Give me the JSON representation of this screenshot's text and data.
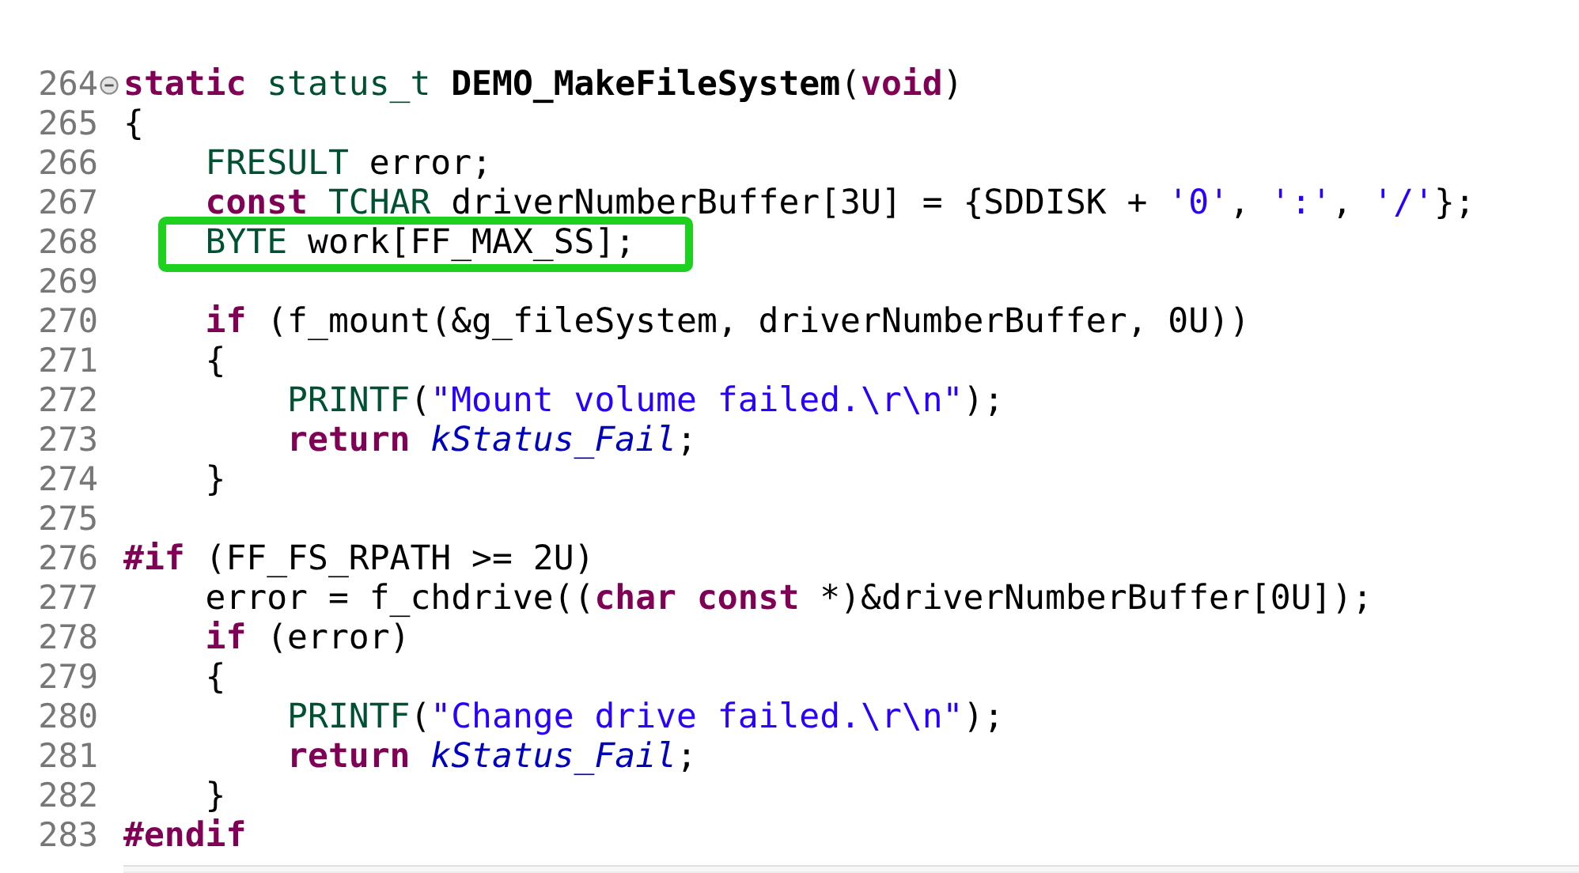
{
  "editor": {
    "lines": [
      {
        "number": "264",
        "foldable": true,
        "boxed": false,
        "tokens": [
          {
            "kind": "keyword",
            "text": "static"
          },
          {
            "kind": "type",
            "text": " status_t"
          },
          {
            "kind": "declaration",
            "text": " DEMO_MakeFileSystem"
          },
          {
            "kind": "plain",
            "text": "("
          },
          {
            "kind": "keyword",
            "text": "void"
          },
          {
            "kind": "plain",
            "text": ")"
          }
        ]
      },
      {
        "number": "265",
        "foldable": false,
        "boxed": false,
        "tokens": [
          {
            "kind": "plain",
            "text": "{"
          }
        ]
      },
      {
        "number": "266",
        "foldable": false,
        "boxed": false,
        "tokens": [
          {
            "kind": "type",
            "text": "    FRESULT"
          },
          {
            "kind": "plain",
            "text": " error;"
          }
        ]
      },
      {
        "number": "267",
        "foldable": false,
        "boxed": false,
        "tokens": [
          {
            "kind": "keyword",
            "text": "    const"
          },
          {
            "kind": "type",
            "text": " TCHAR"
          },
          {
            "kind": "plain",
            "text": " driverNumberBuffer[3U] = {SDDISK + "
          },
          {
            "kind": "string",
            "text": "'0'"
          },
          {
            "kind": "plain",
            "text": ", "
          },
          {
            "kind": "string",
            "text": "':'"
          },
          {
            "kind": "plain",
            "text": ", "
          },
          {
            "kind": "string",
            "text": "'/'"
          },
          {
            "kind": "plain",
            "text": "};"
          }
        ]
      },
      {
        "number": "268",
        "foldable": false,
        "boxed": true,
        "tokens": [
          {
            "kind": "type",
            "text": "    BYTE"
          },
          {
            "kind": "plain",
            "text": " work[FF_MAX_SS];"
          }
        ]
      },
      {
        "number": "269",
        "foldable": false,
        "boxed": false
      },
      {
        "number": "270",
        "foldable": false,
        "boxed": false,
        "tokens": [
          {
            "kind": "keyword",
            "text": "    if"
          },
          {
            "kind": "plain",
            "text": " (f_mount(&g_fileSystem, driverNumberBuffer, 0U))"
          }
        ]
      },
      {
        "number": "271",
        "foldable": false,
        "boxed": false,
        "tokens": [
          {
            "kind": "plain",
            "text": "    {"
          }
        ]
      },
      {
        "number": "272",
        "foldable": false,
        "boxed": false,
        "tokens": [
          {
            "kind": "type",
            "text": "        PRINTF"
          },
          {
            "kind": "plain",
            "text": "("
          },
          {
            "kind": "string",
            "text": "\"Mount volume failed.\\r\\n\""
          },
          {
            "kind": "plain",
            "text": ");"
          }
        ]
      },
      {
        "number": "273",
        "foldable": false,
        "boxed": false,
        "tokens": [
          {
            "kind": "keyword",
            "text": "        return"
          },
          {
            "kind": "enum",
            "text": " kStatus_Fail"
          },
          {
            "kind": "plain",
            "text": ";"
          }
        ]
      },
      {
        "number": "274",
        "foldable": false,
        "boxed": false,
        "tokens": [
          {
            "kind": "plain",
            "text": "    }"
          }
        ]
      },
      {
        "number": "275",
        "foldable": false,
        "boxed": false
      },
      {
        "number": "276",
        "foldable": false,
        "boxed": false,
        "tokens": [
          {
            "kind": "keyword",
            "text": "#if"
          },
          {
            "kind": "plain",
            "text": " (FF_FS_RPATH >= 2U)"
          }
        ]
      },
      {
        "number": "277",
        "foldable": false,
        "boxed": false,
        "tokens": [
          {
            "kind": "plain",
            "text": "    error = f_chdrive(("
          },
          {
            "kind": "keyword",
            "text": "char"
          },
          {
            "kind": "keyword",
            "text": " const"
          },
          {
            "kind": "plain",
            "text": " *)&driverNumberBuffer[0U]);"
          }
        ]
      },
      {
        "number": "278",
        "foldable": false,
        "boxed": false,
        "tokens": [
          {
            "kind": "keyword",
            "text": "    if"
          },
          {
            "kind": "plain",
            "text": " (error)"
          }
        ]
      },
      {
        "number": "279",
        "foldable": false,
        "boxed": false,
        "tokens": [
          {
            "kind": "plain",
            "text": "    {"
          }
        ]
      },
      {
        "number": "280",
        "foldable": false,
        "boxed": false,
        "tokens": [
          {
            "kind": "type",
            "text": "        PRINTF"
          },
          {
            "kind": "plain",
            "text": "("
          },
          {
            "kind": "string",
            "text": "\"Change drive failed.\\r\\n\""
          },
          {
            "kind": "plain",
            "text": ");"
          }
        ]
      },
      {
        "number": "281",
        "foldable": false,
        "boxed": false,
        "tokens": [
          {
            "kind": "keyword",
            "text": "        return"
          },
          {
            "kind": "enum",
            "text": " kStatus_Fail"
          },
          {
            "kind": "plain",
            "text": ";"
          }
        ]
      },
      {
        "number": "282",
        "foldable": false,
        "boxed": false,
        "tokens": [
          {
            "kind": "plain",
            "text": "    }"
          }
        ]
      },
      {
        "number": "283",
        "foldable": false,
        "boxed": false,
        "tokens": [
          {
            "kind": "keyword",
            "text": "#endif"
          }
        ]
      }
    ]
  }
}
